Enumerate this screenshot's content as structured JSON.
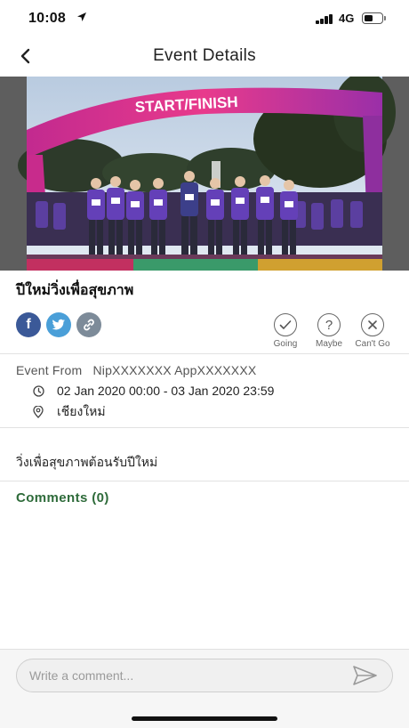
{
  "status_bar": {
    "time": "10:08",
    "network": "4G",
    "battery_level": 0.55,
    "icons": [
      "location-arrow-icon",
      "signal-bars-icon",
      "battery-icon"
    ]
  },
  "nav": {
    "title": "Event Details",
    "back_icon": "chevron-left-icon"
  },
  "hero": {
    "arch_text": "START/FINISH",
    "arch_color": "#e0328c"
  },
  "event": {
    "title": "ปีใหม่วิ่งเพื่อสุขภาพ",
    "from_label": "Event From",
    "from_value": "NipXXXXXXX AppXXXXXXX",
    "date_range": "02 Jan 2020 00:00 - 03 Jan 2020 23:59",
    "location": "เชียงใหม่",
    "description": "วิ่งเพื่อสุขภาพต้อนรับปีใหม่"
  },
  "share": {
    "facebook_glyph": "f",
    "facebook_color": "#3b5998",
    "twitter_color": "#4a9fd8",
    "link_color": "#7d8b99"
  },
  "rsvp": {
    "going": "Going",
    "maybe": "Maybe",
    "maybe_glyph": "?",
    "cant_go": "Can't Go"
  },
  "comments": {
    "title": "Comments (0)",
    "accent": "#2e6b3a",
    "input_placeholder": "Write a comment..."
  }
}
